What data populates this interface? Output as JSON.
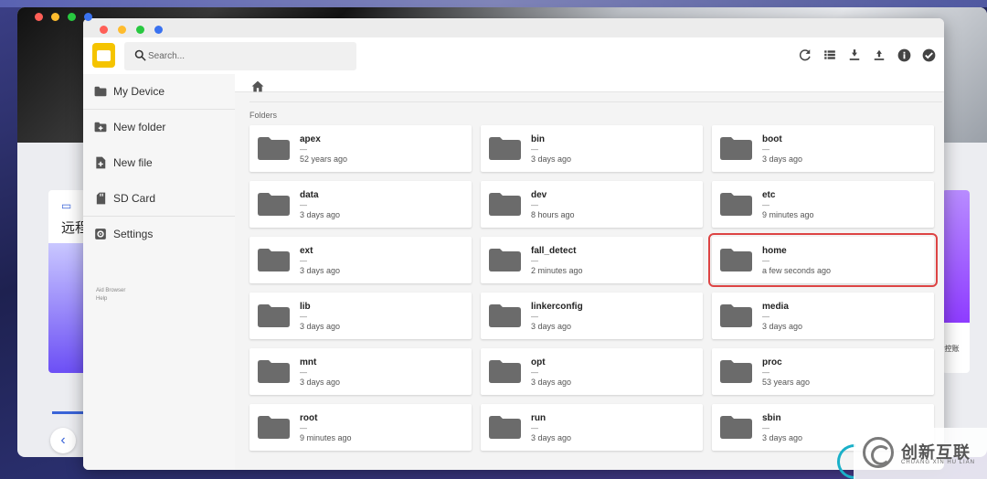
{
  "background": {
    "card_left_label": "远程",
    "card_right_text": "r控账"
  },
  "app": {
    "search": {
      "placeholder": "Search..."
    },
    "toolbar": {
      "icons": [
        "refresh-icon",
        "list-view-icon",
        "download-icon",
        "upload-icon",
        "info-icon",
        "select-icon"
      ]
    },
    "sidebar": {
      "items": [
        {
          "label": "My Device",
          "icon": "folder-icon"
        },
        {
          "label": "New folder",
          "icon": "new-folder-icon"
        },
        {
          "label": "New file",
          "icon": "new-file-icon"
        },
        {
          "label": "SD Card",
          "icon": "sd-card-icon"
        },
        {
          "label": "Settings",
          "icon": "gear-icon"
        }
      ],
      "footer_links": [
        "Aid Browser",
        "Help"
      ]
    },
    "breadcrumb": {
      "icon": "home-icon"
    },
    "section_title": "Folders",
    "folders": [
      {
        "name": "apex",
        "dash": "—",
        "modified": "52 years ago"
      },
      {
        "name": "bin",
        "dash": "—",
        "modified": "3 days ago"
      },
      {
        "name": "boot",
        "dash": "—",
        "modified": "3 days ago"
      },
      {
        "name": "data",
        "dash": "—",
        "modified": "3 days ago"
      },
      {
        "name": "dev",
        "dash": "—",
        "modified": "8 hours ago"
      },
      {
        "name": "etc",
        "dash": "—",
        "modified": "9 minutes ago"
      },
      {
        "name": "ext",
        "dash": "—",
        "modified": "3 days ago"
      },
      {
        "name": "fall_detect",
        "dash": "—",
        "modified": "2 minutes ago"
      },
      {
        "name": "home",
        "dash": "—",
        "modified": "a few seconds ago",
        "highlighted": true
      },
      {
        "name": "lib",
        "dash": "—",
        "modified": "3 days ago"
      },
      {
        "name": "linkerconfig",
        "dash": "—",
        "modified": "3 days ago"
      },
      {
        "name": "media",
        "dash": "—",
        "modified": "3 days ago"
      },
      {
        "name": "mnt",
        "dash": "—",
        "modified": "3 days ago"
      },
      {
        "name": "opt",
        "dash": "—",
        "modified": "3 days ago"
      },
      {
        "name": "proc",
        "dash": "—",
        "modified": "53 years ago"
      },
      {
        "name": "root",
        "dash": "—",
        "modified": "9 minutes ago"
      },
      {
        "name": "run",
        "dash": "—",
        "modified": "3 days ago"
      },
      {
        "name": "sbin",
        "dash": "—",
        "modified": "3 days ago"
      }
    ],
    "colors": {
      "accent_yellow": "#f5c400",
      "folder_grey": "#6b6b6b",
      "highlight_red": "#dd4444",
      "traffic_red": "#ff5f57",
      "traffic_yellow": "#febc2e",
      "traffic_green": "#28c840",
      "traffic_blue": "#3a72f0"
    }
  },
  "watermark": {
    "title": "创新互联",
    "subtitle": "CHUANG XIN HU LIAN"
  }
}
